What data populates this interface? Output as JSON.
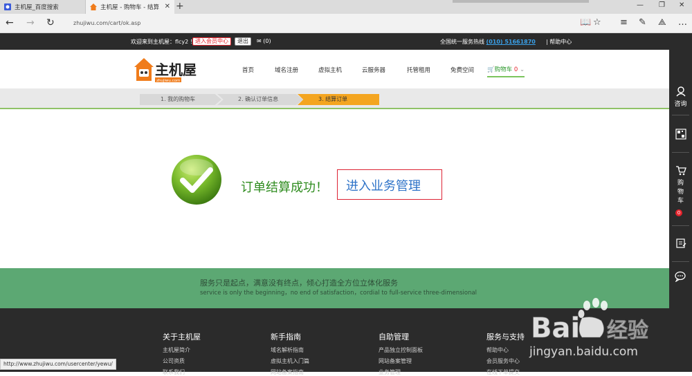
{
  "browser": {
    "tabs": [
      {
        "title": "主机屋_百度搜索"
      },
      {
        "title": "主机屋 - 购物车 - 结算"
      }
    ],
    "new_tab": "+",
    "url": "zhujiwu.com/cart/ok.asp",
    "status_url": "http://www.zhujiwu.com/usercenter/yewu/"
  },
  "topbar": {
    "welcome": "欢迎来到主机屋：flcy2 ！",
    "member_center": "进入会员中心",
    "logout": "退出",
    "messages": "(0)",
    "hotline_label": "全国统一服务热线",
    "hotline_number": "(010) 51661870",
    "separator": "|",
    "help_center": "帮助中心"
  },
  "logo": {
    "text": "主机屋",
    "sub": "zhujiwu.com"
  },
  "nav": {
    "items": [
      "首页",
      "域名注册",
      "虚拟主机",
      "云服务器",
      "托管租用",
      "免费空间"
    ],
    "cart_label": "购物车",
    "cart_count": "0"
  },
  "steps": [
    {
      "label": "1. 我的购物车"
    },
    {
      "label": "2. 确认订单信息"
    },
    {
      "label": "3. 结算订单"
    }
  ],
  "main": {
    "success_text": "订单结算成功！",
    "manage_link": "进入业务管理"
  },
  "slogan": {
    "cn": "服务只是起点，满意没有终点，倾心打造全方位立体化服务",
    "en": "service is only the beginning，no end of satisfaction，cordial to full-service three-dimensional"
  },
  "footer": {
    "columns": [
      {
        "title": "关于主机屋",
        "links": [
          "主机屋简介",
          "公司资质",
          "联系我们"
        ]
      },
      {
        "title": "新手指南",
        "links": [
          "域名解析指南",
          "虚拟主机入门篇",
          "网站备案指南"
        ]
      },
      {
        "title": "自助管理",
        "links": [
          "产品独立控制面板",
          "网站备案管理",
          "业务管理"
        ]
      },
      {
        "title": "服务与支持",
        "links": [
          "帮助中心",
          "会员服务中心",
          "在线下单提交"
        ]
      }
    ]
  },
  "sidebar": {
    "consult": "咨询",
    "cart_chars": [
      "购",
      "物",
      "车"
    ],
    "cart_count": "0"
  },
  "watermark": {
    "brand": "Bai",
    "brand_cn": "经验",
    "domain": "jingyan.baidu.com"
  },
  "colors": {
    "topbar_bg": "#2b2b2b",
    "accent_orange": "#f4a520",
    "success_green": "#2f8c1f",
    "link_blue": "#2e73c8",
    "slogan_bg": "#5ca873",
    "red": "#e5232c"
  }
}
